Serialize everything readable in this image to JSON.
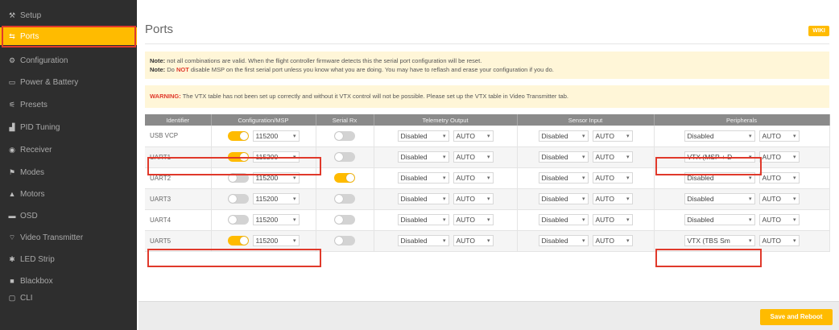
{
  "sidebar": {
    "items": [
      {
        "label": "Setup",
        "icon": "wrench-icon",
        "glyph": "⚒"
      },
      {
        "label": "Ports",
        "icon": "plug-icon",
        "glyph": "⇆",
        "active": true
      },
      {
        "label": "Configuration",
        "icon": "gear-icon",
        "glyph": "⚙"
      },
      {
        "label": "Power & Battery",
        "icon": "battery-icon",
        "glyph": "▭"
      },
      {
        "label": "Presets",
        "icon": "presets-icon",
        "glyph": "⚟"
      },
      {
        "label": "PID Tuning",
        "icon": "tuning-icon",
        "glyph": "▟"
      },
      {
        "label": "Receiver",
        "icon": "receiver-icon",
        "glyph": "◉"
      },
      {
        "label": "Modes",
        "icon": "modes-icon",
        "glyph": "⚑"
      },
      {
        "label": "Motors",
        "icon": "motors-icon",
        "glyph": "▲"
      },
      {
        "label": "OSD",
        "icon": "osd-icon",
        "glyph": "▬"
      },
      {
        "label": "Video Transmitter",
        "icon": "vtx-icon",
        "glyph": "⌔"
      },
      {
        "label": "LED Strip",
        "icon": "led-icon",
        "glyph": "✱"
      },
      {
        "label": "Blackbox",
        "icon": "blackbox-icon",
        "glyph": "■"
      },
      {
        "label": "CLI",
        "icon": "terminal-icon",
        "glyph": "▢"
      }
    ]
  },
  "header": {
    "title": "Ports",
    "wiki_label": "WIKI"
  },
  "notes": {
    "note1_label": "Note:",
    "note1_text": " not all combinations are valid. When the flight controller firmware detects this the serial port configuration will be reset.",
    "note2_label": "Note:",
    "note2_pre": " Do ",
    "note2_not": "NOT",
    "note2_post": " disable MSP on the first serial port unless you know what you are doing. You may have to reflash and erase your configuration if you do.",
    "warning_label": "WARNING:",
    "warning_text": " The VTX table has not been set up correctly and without it VTX control will not be possible. Please set up the VTX table in Video Transmitter tab."
  },
  "table": {
    "headers": [
      "Identifier",
      "Configuration/MSP",
      "Serial Rx",
      "Telemetry Output",
      "Sensor Input",
      "Peripherals"
    ],
    "rows": [
      {
        "id": "USB VCP",
        "msp_on": true,
        "msp_baud": "115200",
        "rx_on": false,
        "tel": "Disabled",
        "tel_baud": "AUTO",
        "sensor": "Disabled",
        "sensor_baud": "AUTO",
        "peri": "Disabled",
        "peri_baud": "AUTO"
      },
      {
        "id": "UART1",
        "msp_on": true,
        "msp_baud": "115200",
        "rx_on": false,
        "tel": "Disabled",
        "tel_baud": "AUTO",
        "sensor": "Disabled",
        "sensor_baud": "AUTO",
        "peri": "VTX (MSP + D",
        "peri_baud": "AUTO"
      },
      {
        "id": "UART2",
        "msp_on": false,
        "msp_baud": "115200",
        "rx_on": true,
        "tel": "Disabled",
        "tel_baud": "AUTO",
        "sensor": "Disabled",
        "sensor_baud": "AUTO",
        "peri": "Disabled",
        "peri_baud": "AUTO"
      },
      {
        "id": "UART3",
        "msp_on": false,
        "msp_baud": "115200",
        "rx_on": false,
        "tel": "Disabled",
        "tel_baud": "AUTO",
        "sensor": "Disabled",
        "sensor_baud": "AUTO",
        "peri": "Disabled",
        "peri_baud": "AUTO"
      },
      {
        "id": "UART4",
        "msp_on": false,
        "msp_baud": "115200",
        "rx_on": false,
        "tel": "Disabled",
        "tel_baud": "AUTO",
        "sensor": "Disabled",
        "sensor_baud": "AUTO",
        "peri": "Disabled",
        "peri_baud": "AUTO"
      },
      {
        "id": "UART5",
        "msp_on": true,
        "msp_baud": "115200",
        "rx_on": false,
        "tel": "Disabled",
        "tel_baud": "AUTO",
        "sensor": "Disabled",
        "sensor_baud": "AUTO",
        "peri": "VTX (TBS Sm",
        "peri_baud": "AUTO"
      }
    ]
  },
  "footer": {
    "save_label": "Save and Reboot"
  },
  "colors": {
    "accent": "#ffbb00",
    "highlight": "#e0392b",
    "sidebar": "#2e2e2e"
  }
}
